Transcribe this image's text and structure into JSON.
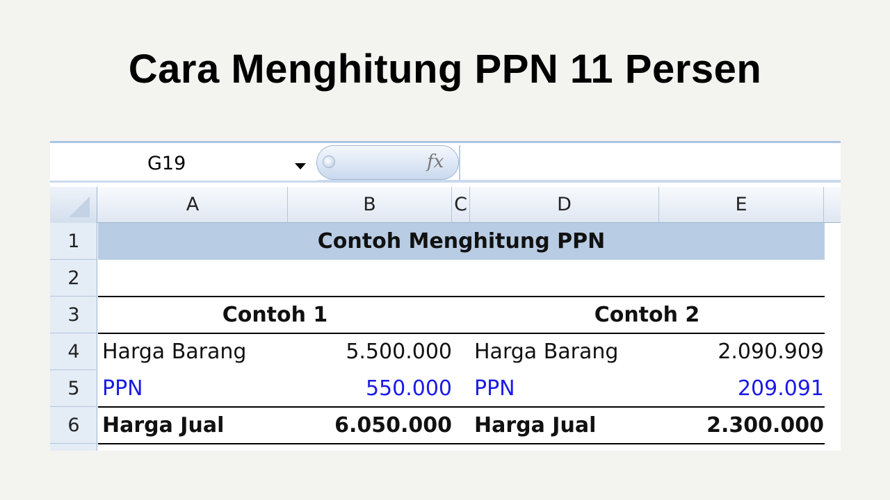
{
  "title": "Cara Menghitung PPN 11 Persen",
  "formula_bar": {
    "name_box": "G19",
    "fx_label": "fx",
    "formula": ""
  },
  "columns": [
    "A",
    "B",
    "C",
    "D",
    "E"
  ],
  "rows": [
    "1",
    "2",
    "3",
    "4",
    "5",
    "6"
  ],
  "sheet": {
    "heading": "Contoh Menghitung PPN",
    "example1": {
      "title": "Contoh 1",
      "harga_barang_label": "Harga Barang",
      "harga_barang_value": "5.500.000",
      "ppn_label": "PPN",
      "ppn_value": "550.000",
      "harga_jual_label": "Harga Jual",
      "harga_jual_value": "6.050.000"
    },
    "example2": {
      "title": "Contoh 2",
      "harga_barang_label": "Harga Barang",
      "harga_barang_value": "2.090.909",
      "ppn_label": "PPN",
      "ppn_value": "209.091",
      "harga_jual_label": "Harga Jual",
      "harga_jual_value": "2.300.000"
    }
  },
  "colors": {
    "heading_band": "#b8cce4",
    "ppn_text": "#1a1ae6",
    "header_bg": "#dfe7f2"
  }
}
